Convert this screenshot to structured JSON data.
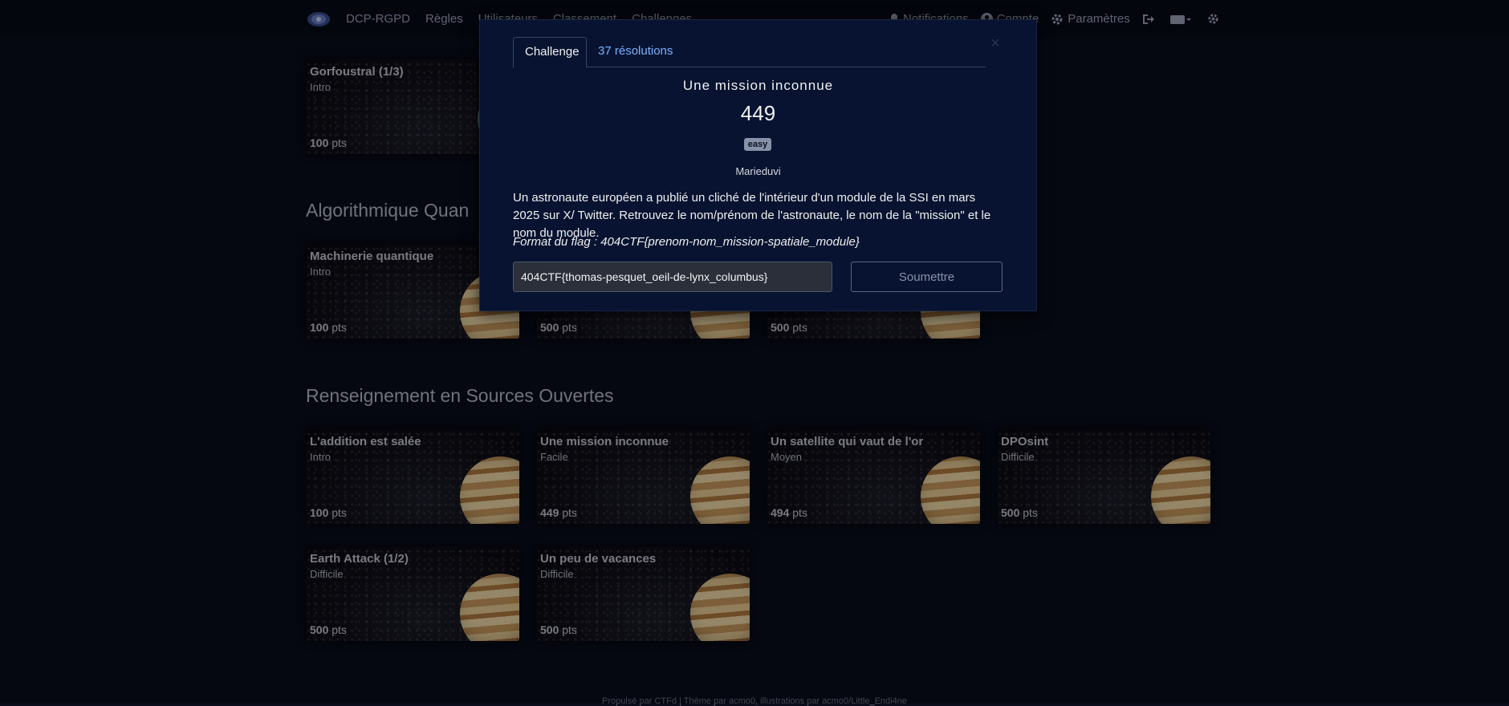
{
  "navbar": {
    "brand": "DCP-RGPD",
    "links": [
      "Règles",
      "Utilisateurs",
      "Classement",
      "Challenges"
    ],
    "notifications": "Notifications",
    "account": "Compte",
    "settings": "Paramètres"
  },
  "sections": [
    {
      "title": "",
      "cards": [
        {
          "title": "Gorfoustral (1/3)",
          "difficulty": "Intro",
          "points": "100",
          "unit": "pts"
        }
      ]
    },
    {
      "title": "Algorithmique Quan",
      "cards": [
        {
          "title": "Machinerie quantique",
          "difficulty": "Intro",
          "points": "100",
          "unit": "pts"
        },
        {
          "title": "",
          "difficulty": "",
          "points": "500",
          "unit": "pts"
        },
        {
          "title": "",
          "difficulty": "",
          "points": "500",
          "unit": "pts"
        }
      ]
    },
    {
      "title": "Renseignement en Sources Ouvertes",
      "cards": [
        {
          "title": "L'addition est salée",
          "difficulty": "Intro",
          "points": "100",
          "unit": "pts"
        },
        {
          "title": "Une mission inconnue",
          "difficulty": "Facile",
          "points": "449",
          "unit": "pts"
        },
        {
          "title": "Un satellite qui vaut de l'or",
          "difficulty": "Moyen",
          "points": "494",
          "unit": "pts"
        },
        {
          "title": "DPOsint",
          "difficulty": "Difficile",
          "points": "500",
          "unit": "pts"
        },
        {
          "title": "Earth Attack (1/2)",
          "difficulty": "Difficile",
          "points": "500",
          "unit": "pts"
        },
        {
          "title": "Un peu de vacances",
          "difficulty": "Difficile",
          "points": "500",
          "unit": "pts"
        }
      ]
    }
  ],
  "footer": "Propulsé par CTFd | Thème par acmo0, illustrations par acmo0/Little_Endi4ne",
  "modal": {
    "tab_challenge": "Challenge",
    "tab_solves": "37 résolutions",
    "close": "×",
    "name": "Une mission inconnue",
    "value": "449",
    "badge": "easy",
    "author": "Marieduvi",
    "description": "Un astronaute européen a publié un cliché de l'intérieur d'un module de la SSI en mars 2025 sur X/ Twitter. Retrouvez le nom/prénom de l'astronaute, le nom de la \"mission\" et le nom du module.",
    "flag_format": "Format du flag : 404CTF{prenom-nom_mission-spatiale_module}",
    "flag_value": "404CTF{thomas-pesquet_oeil-de-lynx_columbus}",
    "submit": "Soumettre"
  },
  "icons": [
    "app-logo-icon",
    "bell-icon",
    "user-icon",
    "gear-icon",
    "logout-icon",
    "language-icon",
    "theme-icon"
  ],
  "colors": {
    "background": "#0a0d1c",
    "modal": "#071330",
    "link": "#7ab2ff",
    "badge": "#8692a8"
  }
}
